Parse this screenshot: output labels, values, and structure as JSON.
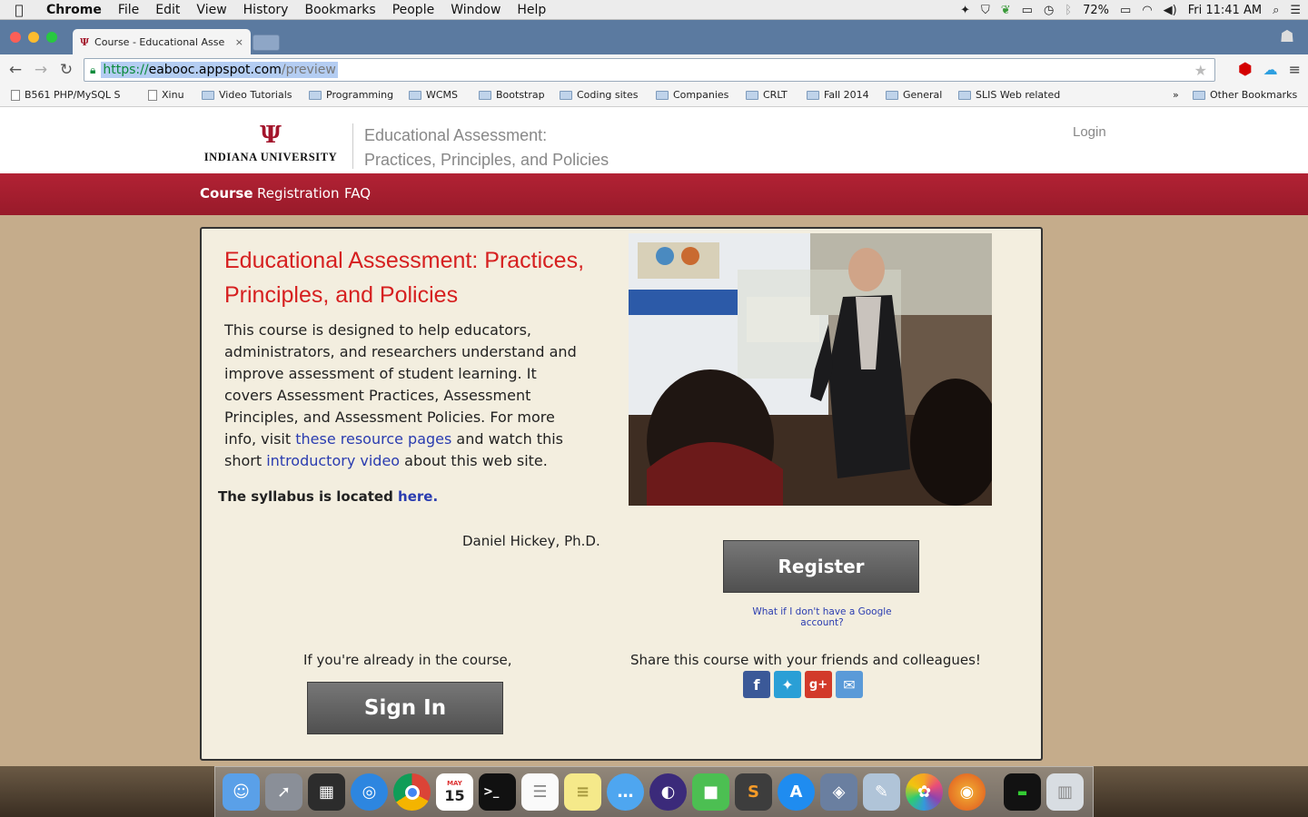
{
  "menubar": {
    "app": "Chrome",
    "items": [
      "File",
      "Edit",
      "View",
      "History",
      "Bookmarks",
      "People",
      "Window",
      "Help"
    ],
    "battery": "72%",
    "clock": "Fri 11:41 AM"
  },
  "tab": {
    "title": "Course - Educational Asse",
    "close": "×"
  },
  "address": {
    "scheme": "https://",
    "host": "eabooc.appspot.com",
    "path": "/preview"
  },
  "bookmarks": {
    "items": [
      "B561 PHP/MySQL S",
      "Xinu",
      "Video Tutorials",
      "Programming",
      "WCMS",
      "Bootstrap",
      "Coding sites",
      "Companies",
      "CRLT",
      "Fall 2014",
      "General",
      "SLIS Web related"
    ],
    "more": "»",
    "other": "Other Bookmarks"
  },
  "site": {
    "logo_mark": "Ψ",
    "logo_text": "INDIANA UNIVERSITY",
    "title_line1": "Educational Assessment:",
    "title_line2": "Practices, Principles, and Policies",
    "login": "Login"
  },
  "nav": {
    "course": "Course",
    "registration": "Registration",
    "faq": "FAQ"
  },
  "card": {
    "title": "Educational Assessment: Practices, Principles, and Policies",
    "desc_1": "This course is designed to help educators, administrators, and researchers understand and improve assessment of student learning. It covers Assessment Practices, Assessment Principles, and Assessment Policies. For more info, visit ",
    "link_resources": "these resource pages",
    "desc_2": " and watch this short ",
    "link_video": "introductory video",
    "desc_3": " about this web site.",
    "syllabus_text": "The syllabus is located ",
    "syllabus_link": "here.",
    "author": "Daniel Hickey, Ph.D.",
    "register": "Register",
    "google_link": "What if I don't have a Google account?",
    "already": "If you're already in the course,",
    "signin": "Sign In",
    "share": "Share this course with your friends and colleagues!"
  },
  "dock": {
    "calendar_month": "MAY",
    "calendar_day": "15"
  },
  "colors": {
    "iu_crimson": "#a3142b",
    "nav_red": "#b22234",
    "title_red": "#d62020",
    "link_blue": "#2a3cb0",
    "page_bg": "#c5ac8b",
    "card_bg": "#f3eedf"
  }
}
